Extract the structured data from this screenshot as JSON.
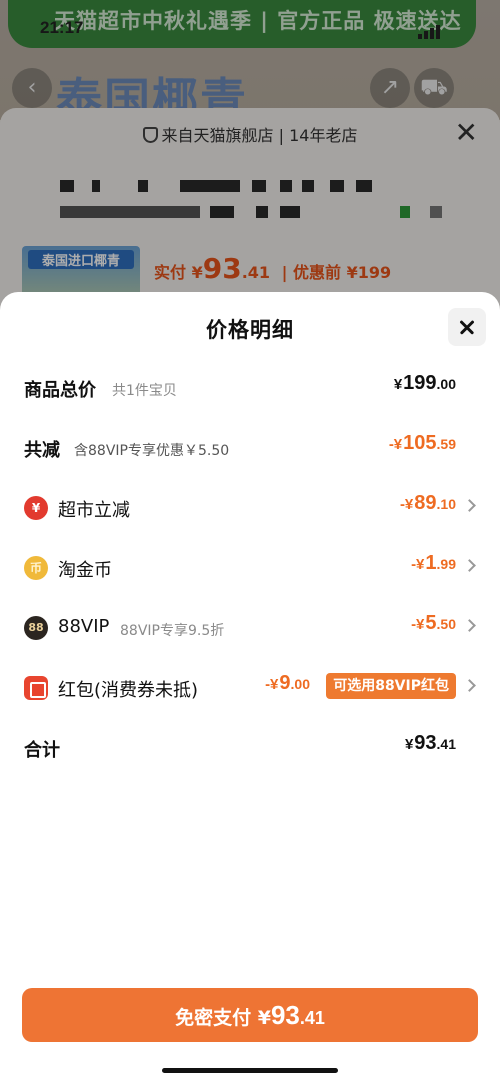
{
  "status_bar": {
    "time": "21:17"
  },
  "background": {
    "promo_banner": "天猫超市中秋礼遇季 | 官方正品 极速送达",
    "page_title": "泰国椰青",
    "shop_info": "来自天猫旗舰店 | 14年老店",
    "thumb_text": "泰国进口椰青",
    "price_prefix": "实付 ¥",
    "price_int": "93",
    "price_dec": ".41",
    "price_before": "| 优惠前 ¥199"
  },
  "modal": {
    "title": "价格明细",
    "rows": {
      "total": {
        "label": "商品总价",
        "sub": "共1件宝贝",
        "cur": "¥",
        "int": "199",
        "dec": ".00"
      },
      "reduce": {
        "label": "共减",
        "sub": "含88VIP专享优惠￥5.50",
        "cur": "-¥",
        "int": "105",
        "dec": ".59"
      },
      "market": {
        "label": "超市立减",
        "icon_char": "¥",
        "cur": "-¥",
        "int": "89",
        "dec": ".10"
      },
      "coin": {
        "label": "淘金币",
        "icon_char": "币",
        "cur": "-¥",
        "int": "1",
        "dec": ".99"
      },
      "vip": {
        "label": "88VIP",
        "icon_char": "88",
        "sub": "88VIP专享9.5折",
        "cur": "-¥",
        "int": "5",
        "dec": ".50"
      },
      "redpack": {
        "label": "红包(消费券未抵)",
        "cur": "-¥",
        "int": "9",
        "dec": ".00",
        "tag": "可选用88VIP红包"
      },
      "sum": {
        "label": "合计",
        "cur": "¥",
        "int": "93",
        "dec": ".41"
      }
    },
    "pay_button": {
      "prefix": "免密支付 ¥",
      "int": "93",
      "dec": ".41"
    }
  },
  "colors": {
    "accent": "#ee7434",
    "price_orange": "#ee6b22",
    "text": "#111111"
  }
}
